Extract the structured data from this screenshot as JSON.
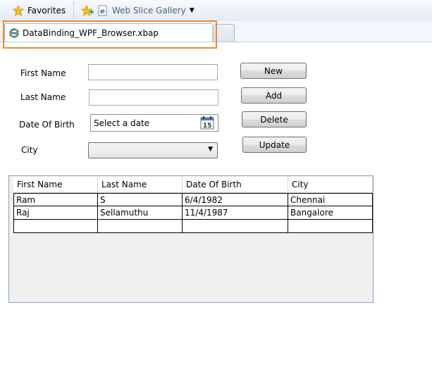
{
  "favorites_bar": {
    "favorites_label": "Favorites",
    "web_slice_gallery_label": "Web Slice Gallery"
  },
  "tab": {
    "title": "DataBinding_WPF_Browser.xbap"
  },
  "form": {
    "first_name_label": "First Name",
    "last_name_label": "Last Name",
    "dob_label": "Date Of Birth",
    "city_label": "City",
    "first_name_value": "",
    "last_name_value": "",
    "dob_placeholder": "Select a date",
    "calendar_day": "15",
    "city_value": ""
  },
  "buttons": {
    "new": "New",
    "add": "Add",
    "delete": "Delete",
    "update": "Update"
  },
  "grid": {
    "columns": [
      "First Name",
      "Last Name",
      "Date Of Birth",
      "City"
    ],
    "rows": [
      [
        "Ram",
        "S",
        "6/4/1982",
        "Chennai"
      ],
      [
        "Raj",
        "Sellamuthu",
        "11/4/1987",
        "Bangalore"
      ],
      [
        "",
        "",
        "",
        ""
      ]
    ]
  },
  "colors": {
    "highlight": "#f08a2c",
    "accent": "#1e73be"
  }
}
